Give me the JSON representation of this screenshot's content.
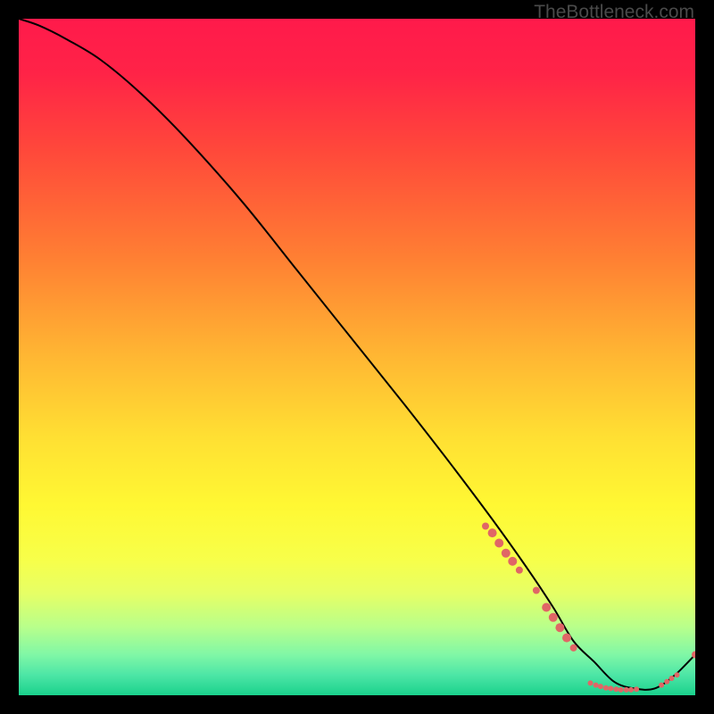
{
  "watermark": "TheBottleneck.com",
  "chart_data": {
    "type": "line",
    "title": "",
    "xlabel": "",
    "ylabel": "",
    "xlim": [
      0,
      100
    ],
    "ylim": [
      0,
      100
    ],
    "gradient_stops": [
      {
        "offset": 0.0,
        "color": "#ff1a4b"
      },
      {
        "offset": 0.08,
        "color": "#ff2347"
      },
      {
        "offset": 0.2,
        "color": "#ff4a3a"
      },
      {
        "offset": 0.35,
        "color": "#ff7e33"
      },
      {
        "offset": 0.5,
        "color": "#ffb733"
      },
      {
        "offset": 0.62,
        "color": "#ffe033"
      },
      {
        "offset": 0.72,
        "color": "#fff833"
      },
      {
        "offset": 0.8,
        "color": "#f7ff4a"
      },
      {
        "offset": 0.85,
        "color": "#e6ff66"
      },
      {
        "offset": 0.9,
        "color": "#b7ff8c"
      },
      {
        "offset": 0.94,
        "color": "#80f7a6"
      },
      {
        "offset": 0.97,
        "color": "#4de6a6"
      },
      {
        "offset": 1.0,
        "color": "#1ad18c"
      }
    ],
    "series": [
      {
        "name": "bottleneck-curve",
        "x": [
          0,
          3,
          7,
          12,
          18,
          25,
          33,
          41,
          49,
          57,
          64,
          70,
          75,
          79,
          82,
          85,
          88,
          91,
          94,
          97,
          100
        ],
        "values": [
          100,
          99,
          97,
          94,
          89,
          82,
          73,
          63,
          53,
          43,
          34,
          26,
          19,
          13,
          8,
          5,
          2,
          1,
          1,
          3,
          6
        ]
      }
    ],
    "markers": {
      "name": "highlighted-points",
      "points": [
        {
          "x": 69.0,
          "y": 25.0,
          "r": 4
        },
        {
          "x": 70.0,
          "y": 24.0,
          "r": 5
        },
        {
          "x": 71.0,
          "y": 22.5,
          "r": 5
        },
        {
          "x": 72.0,
          "y": 21.0,
          "r": 5
        },
        {
          "x": 73.0,
          "y": 19.8,
          "r": 5
        },
        {
          "x": 74.0,
          "y": 18.5,
          "r": 4
        },
        {
          "x": 76.5,
          "y": 15.5,
          "r": 4
        },
        {
          "x": 78.0,
          "y": 13.0,
          "r": 5
        },
        {
          "x": 79.0,
          "y": 11.5,
          "r": 5
        },
        {
          "x": 80.0,
          "y": 10.0,
          "r": 5
        },
        {
          "x": 81.0,
          "y": 8.5,
          "r": 5
        },
        {
          "x": 82.0,
          "y": 7.0,
          "r": 4
        },
        {
          "x": 84.5,
          "y": 1.8,
          "r": 3
        },
        {
          "x": 85.3,
          "y": 1.5,
          "r": 3
        },
        {
          "x": 86.0,
          "y": 1.3,
          "r": 3
        },
        {
          "x": 86.8,
          "y": 1.1,
          "r": 3
        },
        {
          "x": 87.5,
          "y": 1.0,
          "r": 3
        },
        {
          "x": 88.3,
          "y": 0.9,
          "r": 3
        },
        {
          "x": 89.0,
          "y": 0.8,
          "r": 3
        },
        {
          "x": 89.8,
          "y": 0.8,
          "r": 3
        },
        {
          "x": 90.5,
          "y": 0.8,
          "r": 3
        },
        {
          "x": 91.3,
          "y": 0.9,
          "r": 3
        },
        {
          "x": 95.0,
          "y": 1.5,
          "r": 3
        },
        {
          "x": 95.8,
          "y": 2.0,
          "r": 3
        },
        {
          "x": 96.5,
          "y": 2.5,
          "r": 3
        },
        {
          "x": 97.3,
          "y": 3.0,
          "r": 3
        },
        {
          "x": 100.0,
          "y": 6.0,
          "r": 4
        }
      ]
    }
  }
}
